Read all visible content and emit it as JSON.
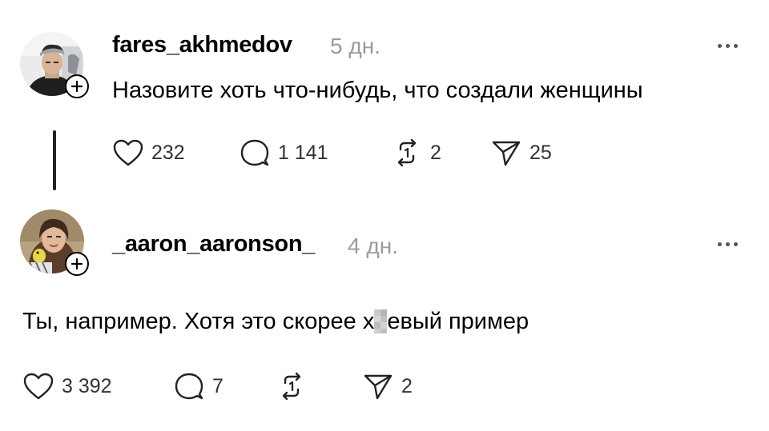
{
  "posts": [
    {
      "username": "fares_akhmedov",
      "time": "5 дн.",
      "text": "Назовите хоть что-нибудь, что создали женщины",
      "actions": {
        "likes": "232",
        "comments": "1 141",
        "reposts": "2",
        "shares": "25"
      }
    },
    {
      "username": "_aaron_aaronson_",
      "time": "4 дн.",
      "text_before": "Ты, например. Хотя это скорее х",
      "text_after": "евый пример",
      "actions": {
        "likes": "3 392",
        "comments": "7",
        "reposts": "",
        "shares": "2"
      }
    }
  ],
  "icons": [
    "heart-icon",
    "comment-icon",
    "repost-icon",
    "share-icon",
    "more-icon",
    "plus-icon"
  ]
}
